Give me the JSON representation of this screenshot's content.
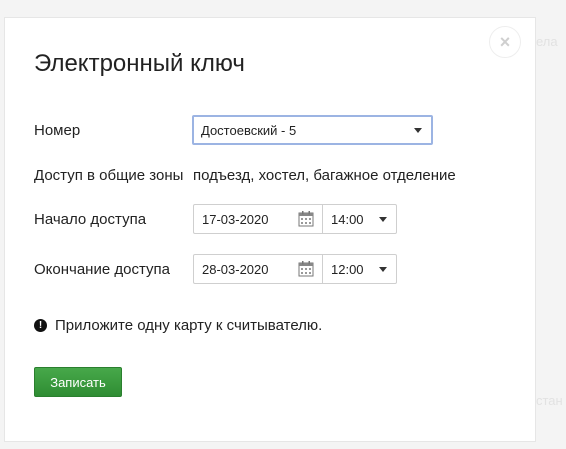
{
  "background": {
    "fragments": [
      "ела",
      "стан"
    ]
  },
  "dialog": {
    "title": "Электронный ключ",
    "close_glyph": "×",
    "rows": {
      "number": {
        "label": "Номер",
        "selected": "Достоевский - 5"
      },
      "common_zones": {
        "label": "Доступ в общие зоны",
        "value": "подъезд, хостел, багажное отделение"
      },
      "start": {
        "label": "Начало доступа",
        "date": "17-03-2020",
        "time": "14:00"
      },
      "end": {
        "label": "Окончание доступа",
        "date": "28-03-2020",
        "time": "12:00"
      }
    },
    "notice": {
      "icon": "exclamation-icon",
      "icon_glyph": "!",
      "text": "Приложите одну карту к считывателю."
    },
    "submit_label": "Записать",
    "colors": {
      "primary": "#3a9a3e",
      "focus_border": "#9cb4e3"
    }
  }
}
